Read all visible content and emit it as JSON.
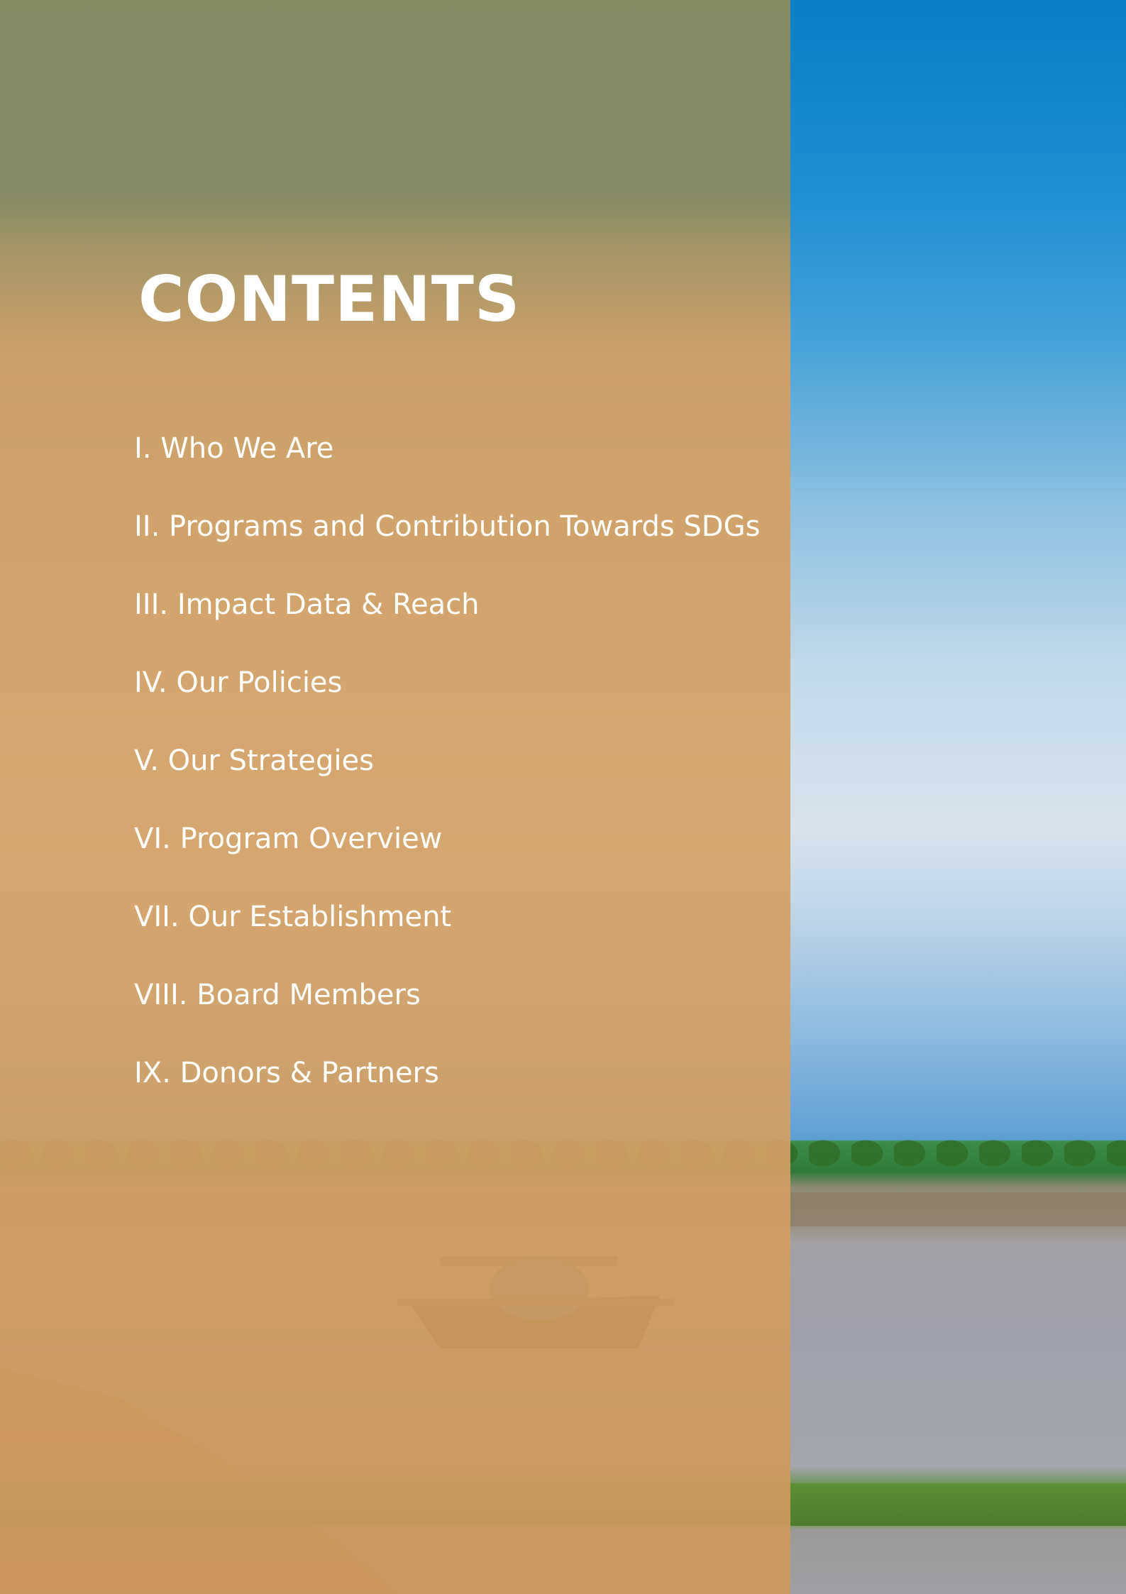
{
  "page": {
    "title": "CONTENTS",
    "toc_items": [
      "I. Who We Are",
      "II. Programs and Contribution Towards SDGs",
      "III. Impact Data & Reach",
      "IV. Our Policies",
      "V. Our Strategies",
      "VI. Program Overview",
      "VII. Our Establishment",
      "VIII. Board Members",
      "IX. Donors & Partners"
    ]
  },
  "colors": {
    "overlay_orange": "#d6a266",
    "overlay_olive": "#868a62",
    "sky_blue": "#0a7fc6",
    "text": "#ffffff"
  },
  "icons": {
    "background_photo": "boat-on-river-landscape"
  }
}
